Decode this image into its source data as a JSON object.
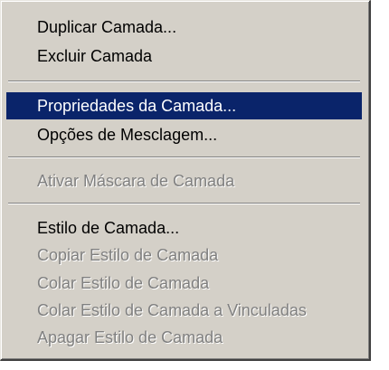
{
  "menu": {
    "items": [
      {
        "label": "Duplicar Camada...",
        "state": "enabled"
      },
      {
        "label": "Excluir Camada",
        "state": "enabled"
      },
      {
        "label": "Propriedades da Camada...",
        "state": "highlighted"
      },
      {
        "label": "Opções de Mesclagem...",
        "state": "enabled"
      },
      {
        "label": "Ativar Máscara de Camada",
        "state": "disabled"
      },
      {
        "label": "Estilo de Camada...",
        "state": "enabled"
      },
      {
        "label": "Copiar Estilo de Camada",
        "state": "disabled"
      },
      {
        "label": "Colar Estilo de Camada",
        "state": "disabled"
      },
      {
        "label": "Colar Estilo de Camada a Vinculadas",
        "state": "disabled"
      },
      {
        "label": "Apagar Estilo de Camada",
        "state": "disabled"
      }
    ],
    "colors": {
      "background": "#d4d0c8",
      "highlight": "#0a246a",
      "disabled_text": "#808080"
    }
  }
}
